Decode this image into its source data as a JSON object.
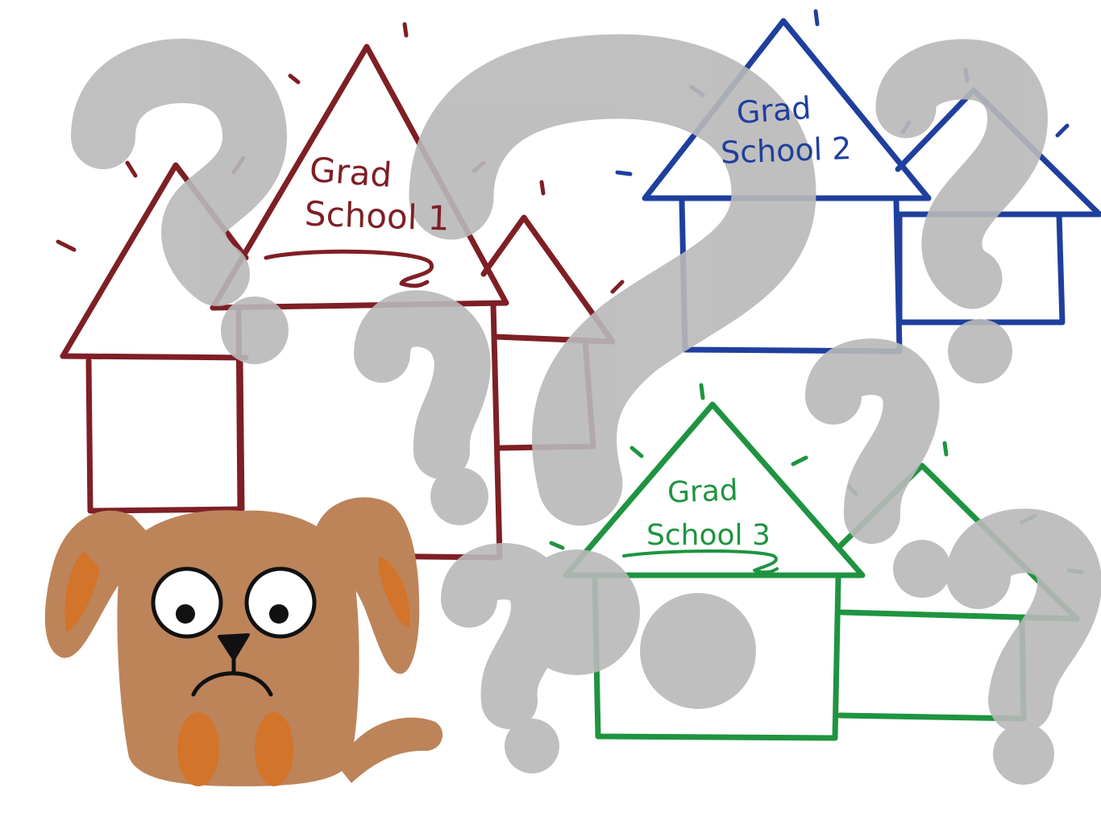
{
  "schools": [
    {
      "line1": "Grad",
      "line2": "School 1",
      "color": "#7e1f25"
    },
    {
      "line1": "Grad",
      "line2": "School 2",
      "color": "#1f3f9e"
    },
    {
      "line1": "Grad",
      "line2": "School 3",
      "color": "#1f9440"
    }
  ],
  "colors": {
    "question_mark": "#b9b9b9",
    "dog_body": "#bd845a",
    "dog_patch": "#d2742a",
    "outline": "#111111"
  },
  "icons": {
    "background": "question-mark-icon",
    "character": "confused-dog",
    "buildings": "house-outline"
  }
}
